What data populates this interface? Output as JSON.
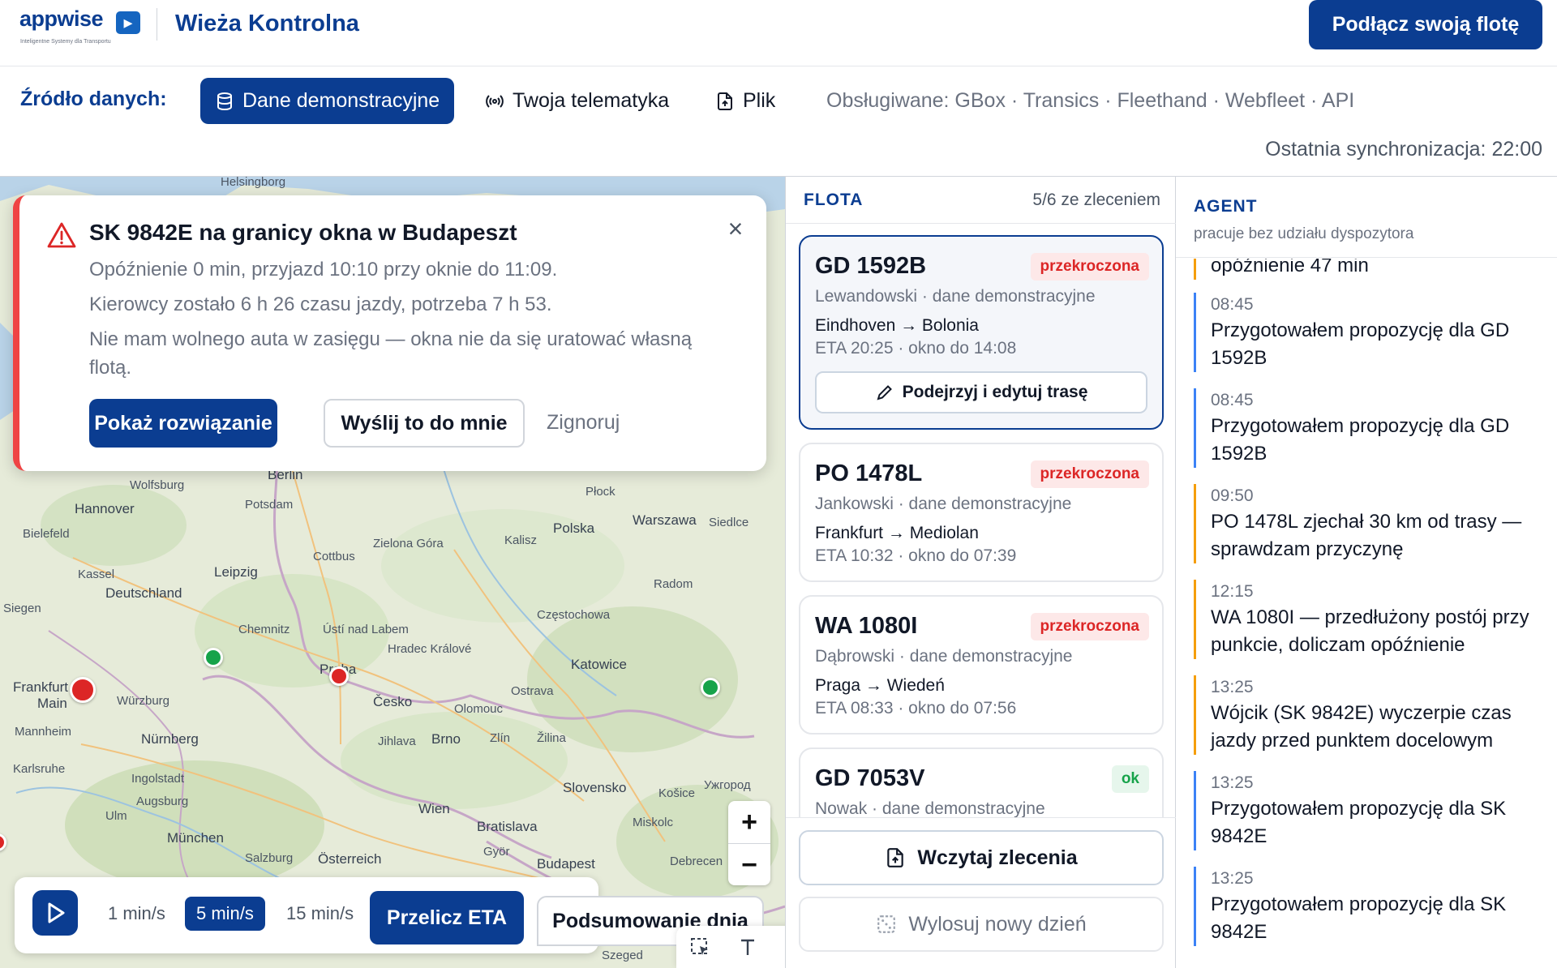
{
  "header": {
    "logo_text": "appwise",
    "logo_tagline": "Inteligentne Systemy dla Transportu",
    "app_title": "Wieża Kontrolna",
    "connect_button": "Podłącz swoją flotę"
  },
  "source_bar": {
    "label": "Źródło danych:",
    "options": [
      {
        "label": "Dane demonstracyjne",
        "icon": "database-icon",
        "active": true
      },
      {
        "label": "Twoja telematyka",
        "icon": "broadcast-icon",
        "active": false
      },
      {
        "label": "Plik",
        "icon": "file-upload-icon",
        "active": false
      }
    ],
    "supported": "Obsługiwane: GBox · Transics · Fleethand · Webfleet · API",
    "last_sync": "Ostatnia synchronizacja: 22:00"
  },
  "map": {
    "labels": [
      "Helsingborg",
      "Wolfsburg",
      "Hannover",
      "Bielefeld",
      "Kassel",
      "Deutschland",
      "Siegen",
      "Frankfurt",
      "Main",
      "Würzburg",
      "Mannheim",
      "Nürnberg",
      "Karlsruhe",
      "Ingolstadt",
      "Augsburg",
      "Ulm",
      "München",
      "Salzburg",
      "Österreich",
      "Wien",
      "Bratislava",
      "Budapest",
      "Berlin",
      "Potsdam",
      "Leipzig",
      "Chemnitz",
      "Cottbus",
      "Zielona Góra",
      "Ústí nad Labem",
      "Praha",
      "Hradec Králové",
      "Česko",
      "Jihlava",
      "Brno",
      "Olomouc",
      "Zlín",
      "Ostrava",
      "Žilina",
      "Slovensko",
      "Košice",
      "Miskolc",
      "Györ",
      "Debrecen",
      "Polska",
      "Warszawa",
      "Płock",
      "Kalisz",
      "Siedlce",
      "Radom",
      "Częstochowa",
      "Katowice",
      "Ужгород",
      "Szeged"
    ],
    "zoom_in": "+",
    "zoom_out": "−"
  },
  "alert": {
    "title": "SK 9842E na granicy okna w Budapeszt",
    "lines": [
      "Opóźnienie 0 min, przyjazd 10:10 przy oknie do 11:09.",
      "Kierowcy zostało 6 h 26 czasu jazdy, potrzeba 7 h 53.",
      "Nie mam wolnego auta w zasięgu — okna nie da się uratować własną flotą."
    ],
    "primary": "Pokaż rozwiązanie",
    "secondary": "Wyślij to do mnie",
    "ignore": "Zignoruj"
  },
  "playback": {
    "speeds": [
      "1 min/s",
      "5 min/s",
      "15 min/s"
    ],
    "active_speed": "5 min/s",
    "recalc": "Przelicz ETA",
    "summary": "Podsumowanie dnia"
  },
  "fleet": {
    "title": "FLOTA",
    "count": "5/6 ze zleceniem",
    "vehicles": [
      {
        "id": "GD 1592B",
        "status": "przekroczona",
        "driver": "Lewandowski · dane demonstracyjne",
        "route": "Eindhoven → Bolonia",
        "eta": "ETA 20:25 · okno do 14:08",
        "edit": "Podejrzyj i edytuj trasę"
      },
      {
        "id": "PO 1478L",
        "status": "przekroczona",
        "driver": "Jankowski · dane demonstracyjne",
        "route": "Frankfurt → Mediolan",
        "eta": "ETA 10:32 · okno do 07:39"
      },
      {
        "id": "WA 1080I",
        "status": "przekroczona",
        "driver": "Dąbrowski · dane demonstracyjne",
        "route": "Praga → Wiedeń",
        "eta": "ETA 08:33 · okno do 07:56"
      },
      {
        "id": "GD 7053V",
        "status": "ok",
        "driver": "Nowak · dane demonstracyjne"
      }
    ],
    "load_button": "Wczytaj zlecenia",
    "random_button": "Wylosuj nowy dzień"
  },
  "agent": {
    "title": "AGENT",
    "subtitle": "pracuje bez udziału dyspozytora",
    "entries": [
      {
        "time": "",
        "text": "opóźnienie 47 min",
        "color": "orange"
      },
      {
        "time": "08:45",
        "text": "Przygotowałem propozycję dla GD 1592B",
        "color": "blue"
      },
      {
        "time": "08:45",
        "text": "Przygotowałem propozycję dla GD 1592B",
        "color": "blue"
      },
      {
        "time": "09:50",
        "text": "PO 1478L zjechał 30 km od trasy — sprawdzam przyczynę",
        "color": "orange"
      },
      {
        "time": "12:15",
        "text": "WA 1080I — przedłużony postój przy punkcie, doliczam opóźnienie",
        "color": "orange"
      },
      {
        "time": "13:25",
        "text": "Wójcik (SK 9842E) wyczerpie czas jazdy przed punktem docelowym",
        "color": "orange"
      },
      {
        "time": "13:25",
        "text": "Przygotowałem propozycję dla SK 9842E",
        "color": "blue"
      },
      {
        "time": "13:25",
        "text": "Przygotowałem propozycję dla SK 9842E",
        "color": "blue"
      }
    ]
  },
  "colors": {
    "brand": "#0b3d91",
    "alert": "#ef4444",
    "ok": "#16a34a",
    "warning": "#f59e0b",
    "info": "#3b82f6"
  }
}
